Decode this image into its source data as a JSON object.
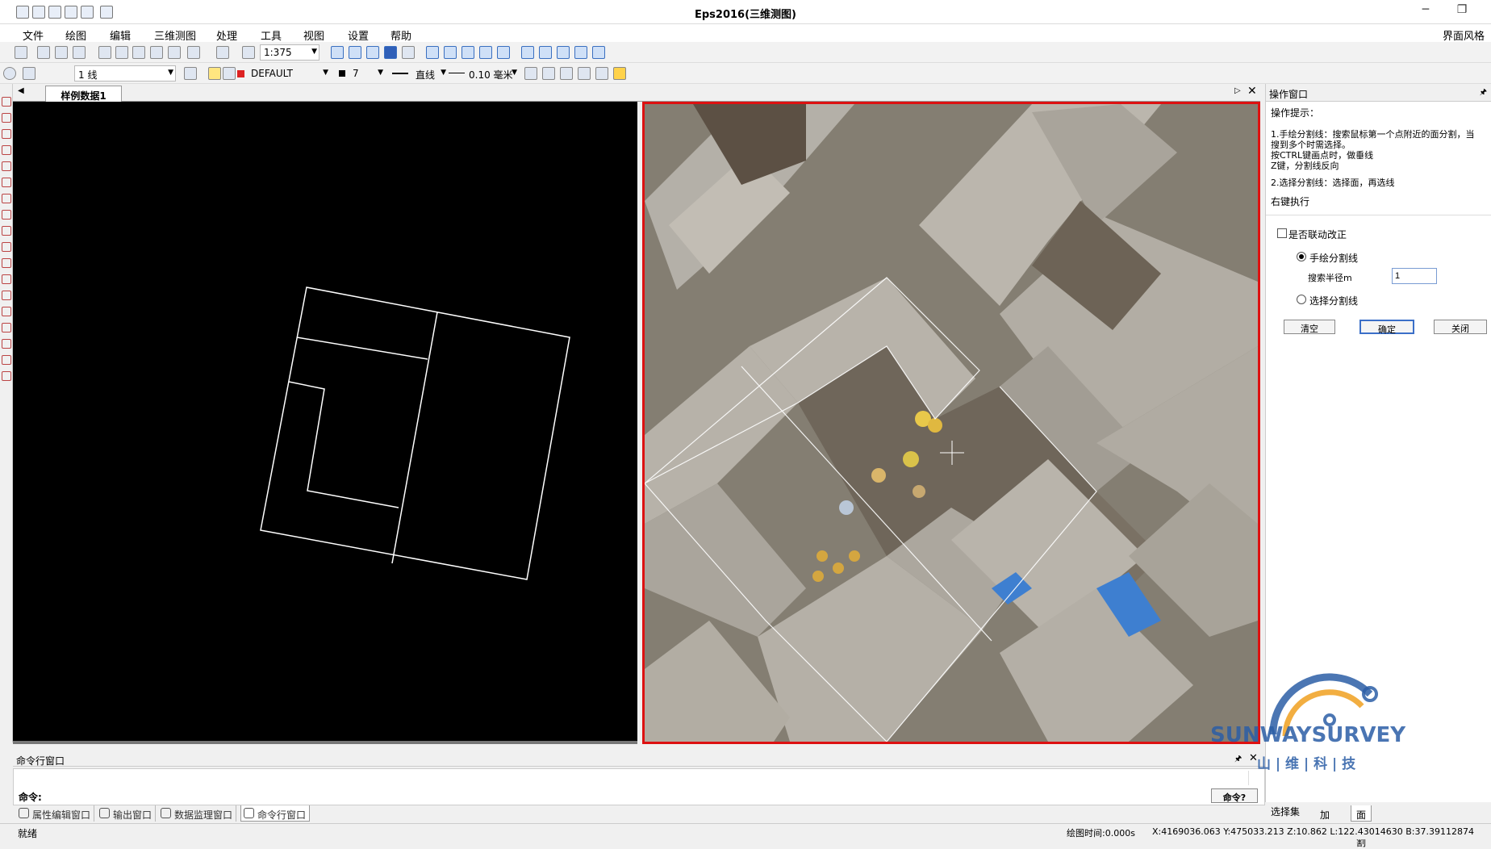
{
  "window": {
    "title": "Eps2016(三维测图)",
    "minimize_glyph": "─",
    "restore_glyph": "❐"
  },
  "menu": {
    "items": [
      "文件",
      "绘图",
      "编辑",
      "三维测图",
      "处理",
      "工具",
      "视图",
      "设置",
      "帮助"
    ],
    "ui_style": "界面风格"
  },
  "toolbar1": {
    "scale": "1:375"
  },
  "toolbar2": {
    "layer": "1 线",
    "style": "DEFAULT",
    "color_index": "7",
    "line_type": "直线",
    "line_width": "0.10 毫米"
  },
  "document": {
    "tab_label": "样例数据1"
  },
  "panel": {
    "title": "操作窗口",
    "hint_title": "操作提示：",
    "hints": [
      "1.手绘分割线：搜索鼠标第一个点附近的面分割，当",
      "搜到多个时需选择。",
      "  按CTRL键画点时，做垂线",
      "  Z键，分割线反向",
      "2.选择分割线：选择面，再选线"
    ],
    "right_click": "右键执行",
    "link_modify_label": "是否联动改正",
    "option_hand": "手绘分割线",
    "search_radius_label": "搜索半径m",
    "search_radius_value": "1",
    "option_select": "选择分割线",
    "btn_clear": "清空",
    "btn_ok": "确定",
    "btn_close": "关闭"
  },
  "command": {
    "header": "命令行窗口",
    "prompt": "命令:",
    "help_button": "命令?"
  },
  "bottom_tabs": [
    "属性编辑窗口",
    "输出窗口",
    "数据监理窗口",
    "命令行窗口"
  ],
  "right_tabs": [
    "选择集",
    "加线",
    "面分割"
  ],
  "status": {
    "left": "就绪",
    "draw_time": "绘图时间:0.000s",
    "coords": "X:4169036.063 Y:475033.213 Z:10.862 L:122.43014630 B:37.39112874"
  },
  "watermark": {
    "brand": "SUNWAYSURVEY",
    "sub": "山 | 维 | 科 | 技"
  },
  "colors": {
    "accent": "#3b6fc8",
    "photo_border": "#dd1111",
    "logo_blue": "#2b5ea6",
    "logo_orange": "#f0a020"
  }
}
